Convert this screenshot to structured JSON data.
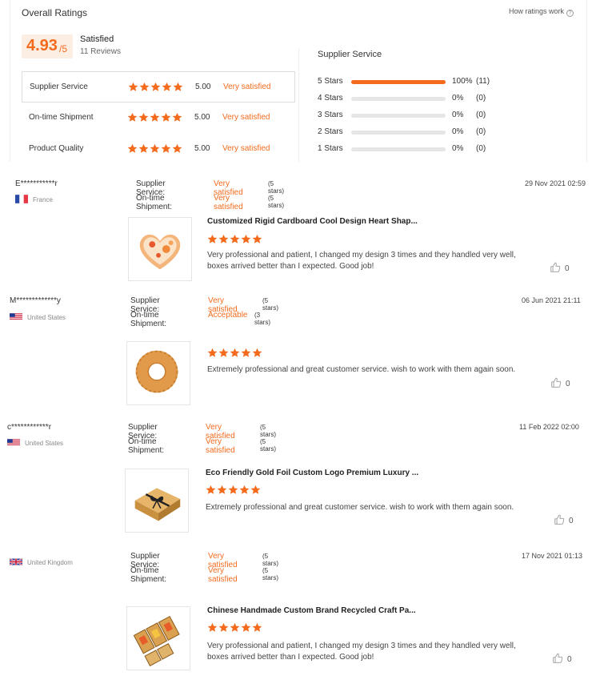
{
  "summary": {
    "title": "Overall Ratings",
    "how_link": "How ratings work",
    "score": "4.93",
    "score_max": "/5",
    "label": "Satisfied",
    "reviews": "11 Reviews",
    "ratings": [
      {
        "label": "Supplier Service",
        "value": "5.00",
        "text": "Very satisfied",
        "stars": 5
      },
      {
        "label": "On-time Shipment",
        "value": "5.00",
        "text": "Very satisfied",
        "stars": 5
      },
      {
        "label": "Product Quality",
        "value": "5.00",
        "text": "Very satisfied",
        "stars": 5
      }
    ],
    "dist_title": "Supplier Service",
    "distribution": [
      {
        "label": "5 Stars",
        "pct": "100%",
        "count": "(11)",
        "fraction": 1.0
      },
      {
        "label": "4 Stars",
        "pct": "0%",
        "count": "(0)",
        "fraction": 0
      },
      {
        "label": "3 Stars",
        "pct": "0%",
        "count": "(0)",
        "fraction": 0
      },
      {
        "label": "2 Stars",
        "pct": "0%",
        "count": "(0)",
        "fraction": 0
      },
      {
        "label": "1 Stars",
        "pct": "0%",
        "count": "(0)",
        "fraction": 0
      }
    ]
  },
  "reviews": [
    {
      "user": "E***********r",
      "country": "France",
      "flag": "france-flag",
      "date": "29 Nov 2021 02:59",
      "supplier_label": "Supplier Service:",
      "supplier_value": "Very satisfied",
      "supplier_stars": "(5 stars)",
      "shipment_label": "On-time Shipment:",
      "shipment_value": "Very satisfied",
      "shipment_stars": "(5 stars)",
      "product": "Customized Rigid Cardboard Cool Design Heart Shap...",
      "stars": 5,
      "body": "Very professional and patient, I changed my design 3 times and they handled very well, boxes arrived better than I expected. Good job!",
      "likes": "0"
    },
    {
      "user": "M*************y",
      "country": "United States",
      "flag": "us-flag",
      "date": "06 Jun 2021 21:11",
      "supplier_label": "Supplier Service:",
      "supplier_value": "Very satisfied",
      "supplier_stars": "(5 stars)",
      "shipment_label": "On-time Shipment:",
      "shipment_value": "Acceptable",
      "shipment_stars": "(3 stars)",
      "product": "",
      "stars": 5,
      "body": "Extremely professional and great customer service. wish to work with them again soon.",
      "likes": "0"
    },
    {
      "user": "c************r",
      "country": "United States",
      "flag": "us-flag",
      "date": "11 Feb 2022 02:00",
      "supplier_label": "Supplier Service:",
      "supplier_value": "Very satisfied",
      "supplier_stars": "(5 stars)",
      "shipment_label": "On-time Shipment:",
      "shipment_value": "Very satisfied",
      "shipment_stars": "(5 stars)",
      "product": "Eco Friendly Gold Foil Custom Logo Premium Luxury ...",
      "stars": 5,
      "body": "Extremely professional and great customer service. wish to work with them again soon.",
      "likes": "0"
    },
    {
      "user": "",
      "country": "United Kingdom",
      "flag": "uk-flag",
      "date": "17 Nov 2021 01:13",
      "supplier_label": "Supplier Service:",
      "supplier_value": "Very satisfied",
      "supplier_stars": "(5 stars)",
      "shipment_label": "On-time Shipment:",
      "shipment_value": "Very satisfied",
      "shipment_stars": "(5 stars)",
      "product": "Chinese Handmade Custom Brand Recycled Craft Pa...",
      "stars": 5,
      "body": "Very professional and patient, I changed my design 3 times and they handled very well, boxes arrived better than I expected. Good job!",
      "likes": "0"
    }
  ],
  "colors": {
    "accent": "#f46b1e",
    "accent_bg": "#fdeee4",
    "bar_empty": "#e6e6e6"
  }
}
